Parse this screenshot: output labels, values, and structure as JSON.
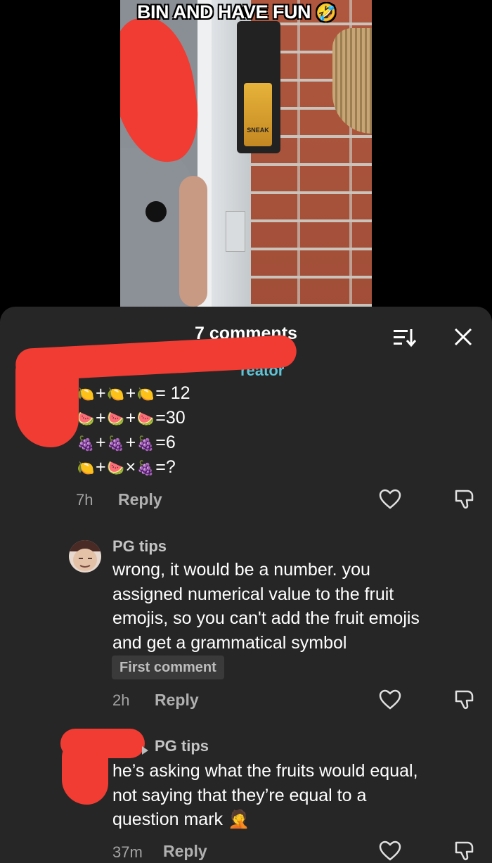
{
  "video": {
    "caption": "BIN AND HAVE FUN",
    "caption_emoji": "🤣",
    "can_label": "SNEAK"
  },
  "panel": {
    "title": "7 comments"
  },
  "comment1": {
    "badge_partial": "reator",
    "equations": [
      {
        "fruits": [
          "🍋",
          "🍋",
          "🍋"
        ],
        "ops": [
          "+",
          "+"
        ],
        "result": "= 12"
      },
      {
        "fruits": [
          "🍉",
          "🍉",
          "🍉"
        ],
        "ops": [
          "+",
          "+"
        ],
        "result": "=30"
      },
      {
        "fruits": [
          "🍇",
          "🍇",
          "🍇"
        ],
        "ops": [
          "+",
          "+"
        ],
        "result": "=6"
      },
      {
        "fruits": [
          "🍋",
          "🍉",
          "🍇"
        ],
        "ops": [
          "+",
          "×"
        ],
        "result": "=?"
      }
    ],
    "time": "7h",
    "reply_label": "Reply"
  },
  "comment2": {
    "author": "PG tips",
    "text_lines": [
      "wrong, it would be a number. you",
      "assigned numerical value to the fruit",
      "emojis, so you can't add the fruit emojis",
      "and get a grammatical symbol"
    ],
    "badge": "First comment",
    "time": "2h",
    "reply_label": "Reply"
  },
  "comment3": {
    "reply_to": "PG tips",
    "text_lines": [
      "he’s asking what the fruits would equal,",
      "not saying that they’re equal to a",
      "question mark"
    ],
    "emoji": "🤦",
    "time": "37m",
    "reply_label": "Reply"
  },
  "icons": {
    "sort": "sort-icon",
    "close": "close-icon",
    "heart": "heart-icon",
    "dislike": "dislike-icon"
  }
}
